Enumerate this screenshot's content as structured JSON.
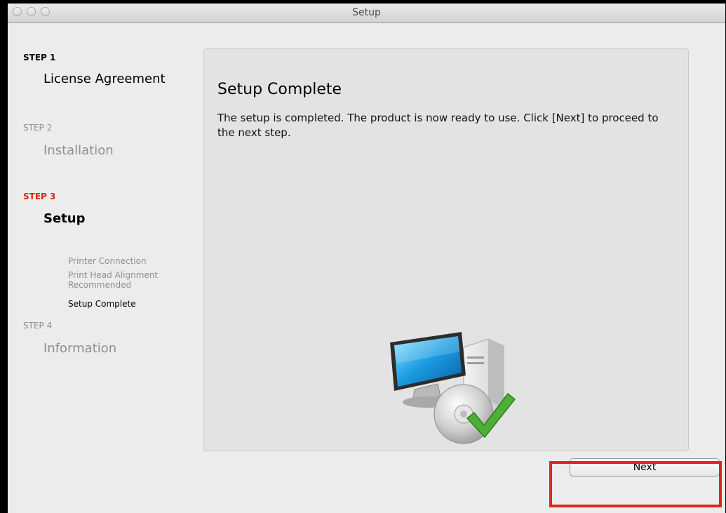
{
  "window": {
    "title": "Setup"
  },
  "sidebar": {
    "steps": [
      {
        "label": "STEP 1",
        "title": "License Agreement",
        "state": "done"
      },
      {
        "label": "STEP 2",
        "title": "Installation",
        "state": "inactive"
      },
      {
        "label": "STEP 3",
        "title": "Setup",
        "state": "active",
        "substeps": [
          "Printer Connection",
          "Print Head Alignment\nRecommended",
          "Setup Complete"
        ]
      },
      {
        "label": "STEP 4",
        "title": "Information",
        "state": "inactive"
      }
    ]
  },
  "content": {
    "title": "Setup Complete",
    "text": "The setup is completed. The product is now ready to use. Click [Next] to proceed to the next step."
  },
  "footer": {
    "next_label": "Next"
  },
  "colors": {
    "active_step": "#d9231a",
    "inactive": "#8f8f8f",
    "highlight": "#e0261d",
    "checkmark": "#4caf37"
  }
}
